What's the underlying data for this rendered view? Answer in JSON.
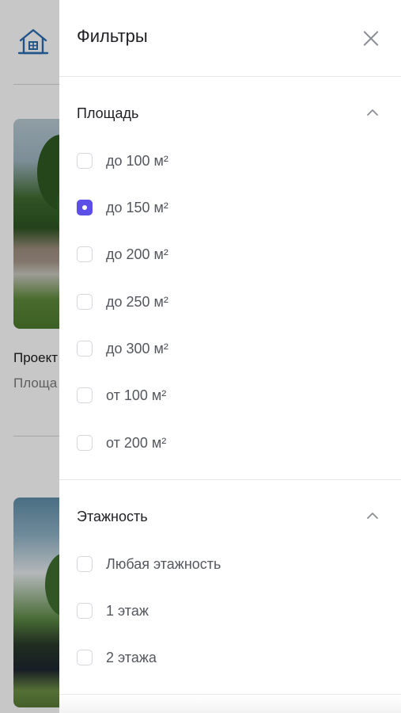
{
  "background": {
    "cards": [
      {
        "title": "Проект",
        "subtitle": "Площа"
      }
    ]
  },
  "drawer": {
    "title": "Фильтры",
    "sections": [
      {
        "title": "Площадь",
        "options": [
          {
            "label": "до 100 м²",
            "checked": false
          },
          {
            "label": "до 150 м²",
            "checked": true
          },
          {
            "label": "до 200 м²",
            "checked": false
          },
          {
            "label": "до 250 м²",
            "checked": false
          },
          {
            "label": "до 300 м²",
            "checked": false
          },
          {
            "label": "от 100 м²",
            "checked": false
          },
          {
            "label": "от 200 м²",
            "checked": false
          }
        ]
      },
      {
        "title": "Этажность",
        "options": [
          {
            "label": "Любая этажность",
            "checked": false
          },
          {
            "label": "1 этаж",
            "checked": false
          },
          {
            "label": "2 этажа",
            "checked": false
          }
        ]
      }
    ]
  },
  "colors": {
    "accent": "#5c4ee8",
    "overlay": "rgba(0,0,0,0.22)",
    "home_icon": "#2b6cb0"
  },
  "icons": {
    "home": "home-icon",
    "close": "close-icon",
    "collapse": "chevron-up-icon"
  }
}
